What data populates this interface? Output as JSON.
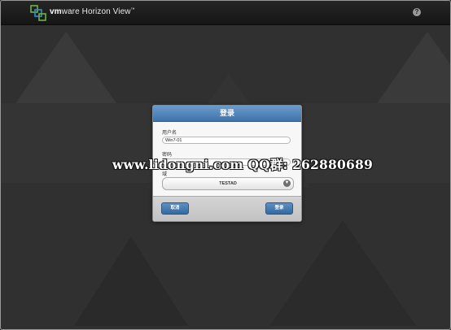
{
  "header": {
    "brand_vm": "vm",
    "brand_ware": "ware",
    "product": "Horizon View",
    "trademark": "™",
    "help_glyph": "?",
    "icons": [
      "vmware-logo-icon",
      "help-icon"
    ]
  },
  "dialog": {
    "title": "登录",
    "username_label": "用户名",
    "username_value": "Win7-01",
    "password_label": "密码",
    "password_value": "",
    "domain_label": "域",
    "domain_value": "TESTAD",
    "cancel_label": "取消",
    "login_label": "登录"
  },
  "watermark": "www.lidongni.com  QQ群: 262880689",
  "colors": {
    "accent_blue": "#3f73aa",
    "background": "#303030",
    "topbar": "#1a1a1a"
  }
}
